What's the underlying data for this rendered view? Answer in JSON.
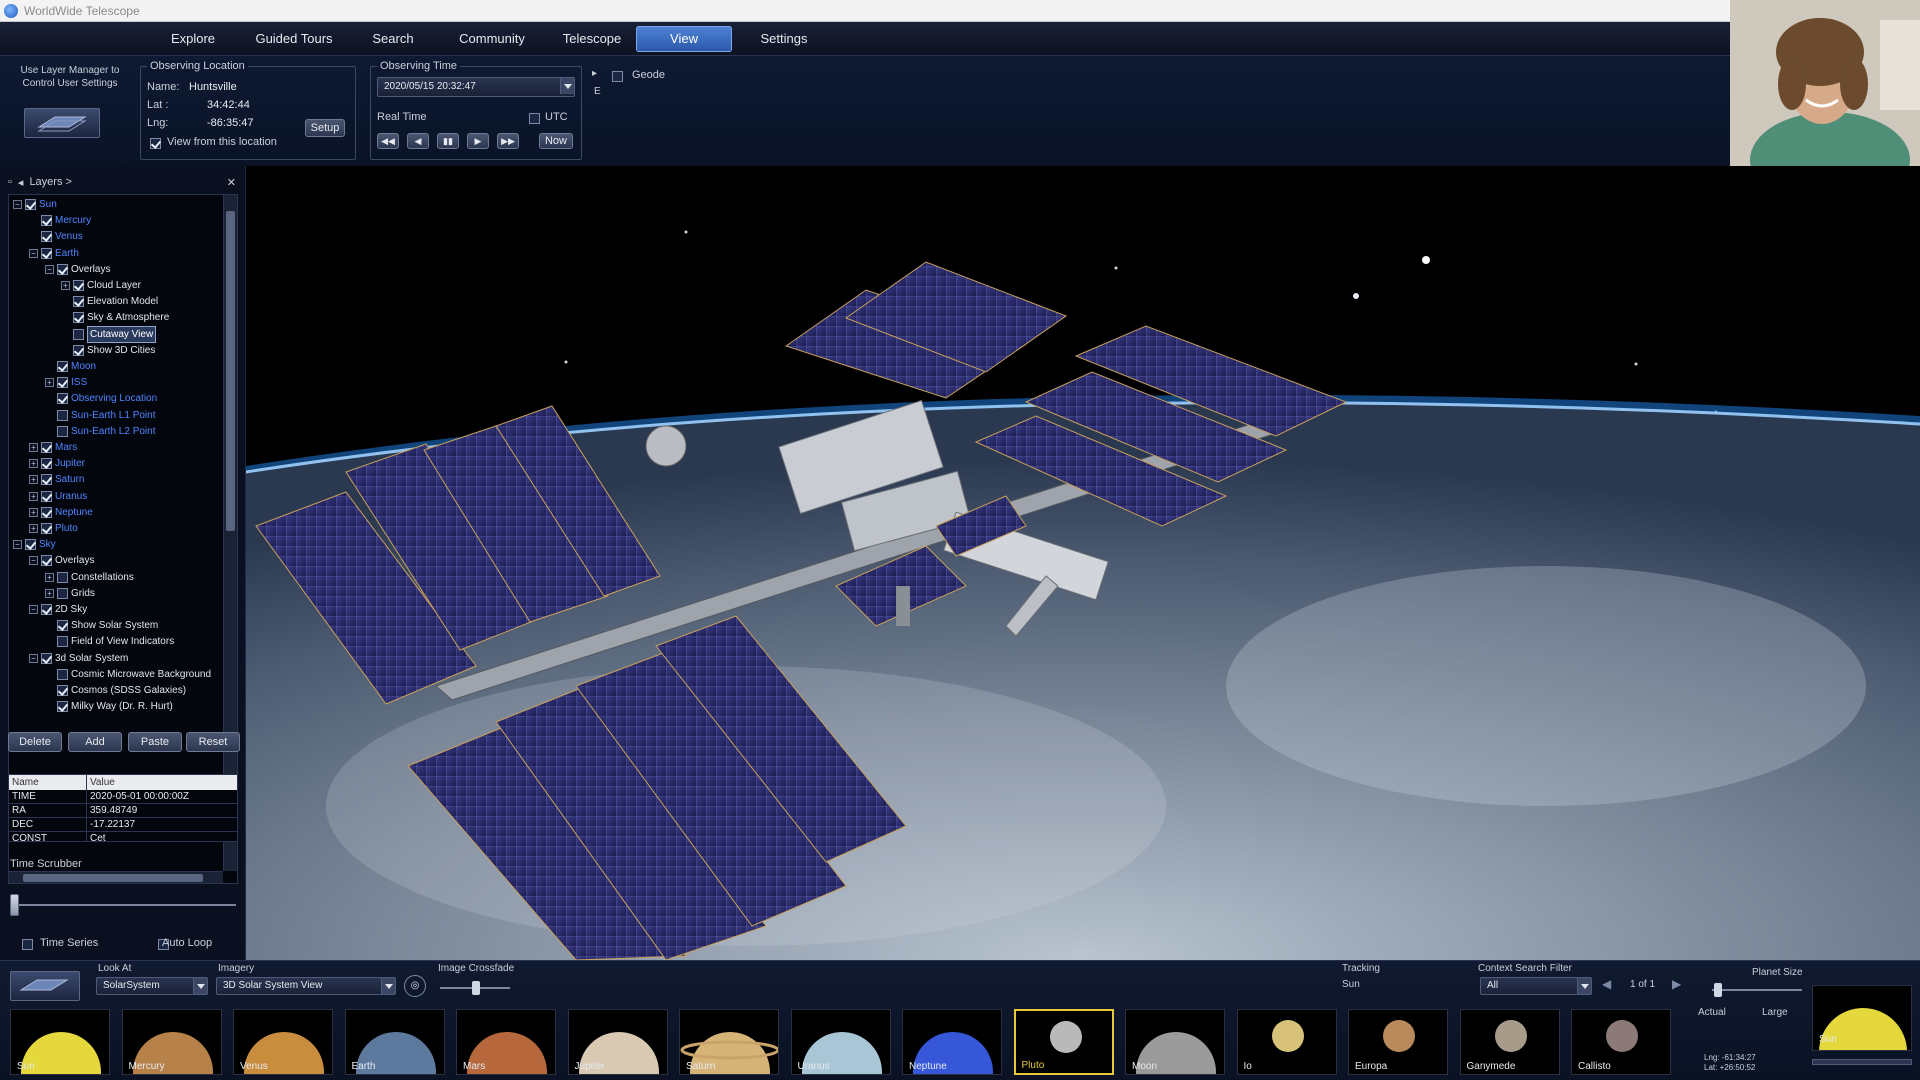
{
  "window": {
    "title": "WorldWide Telescope"
  },
  "menu": {
    "items": [
      "Explore",
      "Guided Tours",
      "Search",
      "Community",
      "Telescope",
      "View",
      "Settings"
    ],
    "active": "View"
  },
  "top_controls": {
    "layer_manager_note": "Use Layer Manager to Control User Settings",
    "observing_location": {
      "title": "Observing Location",
      "name_label": "Name:",
      "name": "Huntsville",
      "lat_label": "Lat :",
      "lat": "34:42:44",
      "lng_label": "Lng:",
      "lng": "-86:35:47",
      "view_from_label": "View from this location",
      "setup_label": "Setup"
    },
    "observing_time": {
      "title": "Observing Time",
      "datetime": "2020/05/15   20:32:47",
      "real_time_label": "Real Time",
      "utc_label": "UTC",
      "buttons": [
        "◀◀",
        "◀",
        "▮▮",
        "▶",
        "▶▶"
      ],
      "now_label": "Now"
    },
    "geode_label": "Geode",
    "e_label": "E"
  },
  "layers": {
    "header": "Layers >",
    "tree": [
      {
        "label": "Sun",
        "depth": 0,
        "exp": "-",
        "checked": true,
        "style": "link"
      },
      {
        "label": "Mercury",
        "depth": 1,
        "exp": "",
        "checked": true,
        "style": "link"
      },
      {
        "label": "Venus",
        "depth": 1,
        "exp": "",
        "checked": true,
        "style": "link"
      },
      {
        "label": "Earth",
        "depth": 1,
        "exp": "-",
        "checked": true,
        "style": "link"
      },
      {
        "label": "Overlays",
        "depth": 2,
        "exp": "-",
        "checked": true,
        "style": "plain"
      },
      {
        "label": "Cloud Layer",
        "depth": 3,
        "exp": "+",
        "checked": true,
        "style": "plain"
      },
      {
        "label": "Elevation Model",
        "depth": 3,
        "exp": "",
        "checked": true,
        "style": "plain"
      },
      {
        "label": "Sky & Atmosphere",
        "depth": 3,
        "exp": "",
        "checked": true,
        "style": "plain"
      },
      {
        "label": "Cutaway View",
        "depth": 3,
        "exp": "",
        "checked": false,
        "style": "sel"
      },
      {
        "label": "Show 3D Cities",
        "depth": 3,
        "exp": "",
        "checked": true,
        "style": "plain"
      },
      {
        "label": "Moon",
        "depth": 2,
        "exp": "",
        "checked": true,
        "style": "link"
      },
      {
        "label": "ISS",
        "depth": 2,
        "exp": "+",
        "checked": true,
        "style": "link"
      },
      {
        "label": "Observing Location",
        "depth": 2,
        "exp": "",
        "checked": true,
        "style": "link"
      },
      {
        "label": "Sun-Earth L1 Point",
        "depth": 2,
        "exp": "",
        "checked": false,
        "style": "link"
      },
      {
        "label": "Sun-Earth L2 Point",
        "depth": 2,
        "exp": "",
        "checked": false,
        "style": "link"
      },
      {
        "label": "Mars",
        "depth": 1,
        "exp": "+",
        "checked": true,
        "style": "link"
      },
      {
        "label": "Jupiter",
        "depth": 1,
        "exp": "+",
        "checked": true,
        "style": "link"
      },
      {
        "label": "Saturn",
        "depth": 1,
        "exp": "+",
        "checked": true,
        "style": "link"
      },
      {
        "label": "Uranus",
        "depth": 1,
        "exp": "+",
        "checked": true,
        "style": "link"
      },
      {
        "label": "Neptune",
        "depth": 1,
        "exp": "+",
        "checked": true,
        "style": "link"
      },
      {
        "label": "Pluto",
        "depth": 1,
        "exp": "+",
        "checked": true,
        "style": "link"
      },
      {
        "label": "Sky",
        "depth": 0,
        "exp": "-",
        "checked": true,
        "style": "link"
      },
      {
        "label": "Overlays",
        "depth": 1,
        "exp": "-",
        "checked": true,
        "style": "plain"
      },
      {
        "label": "Constellations",
        "depth": 2,
        "exp": "+",
        "checked": false,
        "style": "plain"
      },
      {
        "label": "Grids",
        "depth": 2,
        "exp": "+",
        "checked": false,
        "style": "plain"
      },
      {
        "label": "2D Sky",
        "depth": 1,
        "exp": "-",
        "checked": true,
        "style": "plain"
      },
      {
        "label": "Show Solar System",
        "depth": 2,
        "exp": "",
        "checked": true,
        "style": "plain"
      },
      {
        "label": "Field of View Indicators",
        "depth": 2,
        "exp": "",
        "checked": false,
        "style": "plain"
      },
      {
        "label": "3d Solar System",
        "depth": 1,
        "exp": "-",
        "checked": true,
        "style": "plain"
      },
      {
        "label": "Cosmic Microwave Background",
        "depth": 2,
        "exp": "",
        "checked": false,
        "style": "plain"
      },
      {
        "label": "Cosmos (SDSS Galaxies)",
        "depth": 2,
        "exp": "",
        "checked": true,
        "style": "plain"
      },
      {
        "label": "Milky Way (Dr. R. Hurt)",
        "depth": 2,
        "exp": "",
        "checked": true,
        "style": "plain"
      }
    ],
    "buttons": [
      "Delete",
      "Add",
      "Paste",
      "Reset"
    ],
    "table": {
      "headers": [
        "Name",
        "Value"
      ],
      "rows": [
        [
          "TIME",
          "2020-05-01 00:00:00Z"
        ],
        [
          "RA",
          "359.48749"
        ],
        [
          "DEC",
          "-17.22137"
        ],
        [
          "CONST",
          "Cet"
        ]
      ]
    },
    "time_scrubber_label": "Time Scrubber",
    "time_series_label": "Time Series",
    "auto_loop_label": "Auto Loop"
  },
  "bottom": {
    "look_at_label": "Look At",
    "look_at_value": "SolarSystem",
    "imagery_label": "Imagery",
    "imagery_value": "3D Solar System View",
    "crossfade_label": "Image Crossfade",
    "tracking_label": "Tracking",
    "tracking_value": "Sun",
    "context_filter_label": "Context Search Filter",
    "context_filter_value": "All",
    "page_indicator": "1 of 1",
    "planet_size_label": "Planet Size",
    "actual_label": "Actual",
    "large_label": "Large",
    "coords_lng": "Lng: -61:34:27",
    "coords_lat": "Lat: +26:50:52",
    "thumbnails": [
      {
        "name": "Sun",
        "color": "#e4d83c",
        "kind": "sun"
      },
      {
        "name": "Mercury",
        "color": "#b7814a",
        "kind": "planet"
      },
      {
        "name": "Venus",
        "color": "#c98d3e",
        "kind": "planet"
      },
      {
        "name": "Earth",
        "color": "#5d7a9e",
        "kind": "planet"
      },
      {
        "name": "Mars",
        "color": "#b6683c",
        "kind": "planet"
      },
      {
        "name": "Jupiter",
        "color": "#d9c9b3",
        "kind": "planet"
      },
      {
        "name": "Saturn",
        "color": "#d6b478",
        "kind": "saturn"
      },
      {
        "name": "Uranus",
        "color": "#a9c6d6",
        "kind": "planet"
      },
      {
        "name": "Neptune",
        "color": "#3557d8",
        "kind": "planet"
      },
      {
        "name": "Pluto",
        "color": "#b9b9b9",
        "kind": "small",
        "selected": true
      },
      {
        "name": "Moon",
        "color": "#9a9a9a",
        "kind": "planet"
      },
      {
        "name": "Io",
        "color": "#d8c27a",
        "kind": "small"
      },
      {
        "name": "Europa",
        "color": "#b98a5c",
        "kind": "small"
      },
      {
        "name": "Ganymede",
        "color": "#a99b8a",
        "kind": "small"
      },
      {
        "name": "Callisto",
        "color": "#8c7a78",
        "kind": "small"
      }
    ],
    "preview_name": "Sun",
    "preview_color": "#e4d83c"
  },
  "colors": {
    "accent_blue": "#4f83d8",
    "link_blue": "#4f86ff",
    "selected_yellow": "#e6c93a"
  }
}
